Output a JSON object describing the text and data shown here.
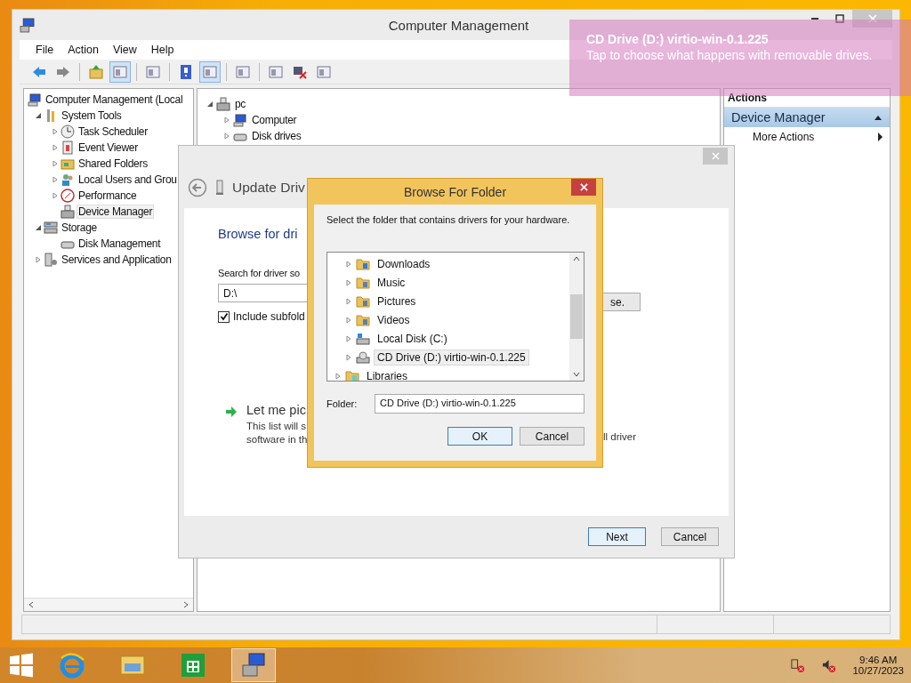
{
  "window": {
    "title": "Computer Management"
  },
  "menu": [
    "File",
    "Action",
    "View",
    "Help"
  ],
  "toolbar": [
    {
      "on": false
    },
    {
      "on": false
    },
    {
      "on": false
    },
    {
      "on": true
    },
    {
      "on": false
    },
    {
      "on": false
    },
    {
      "on": true
    },
    {
      "on": false
    },
    {
      "on": false
    },
    {
      "on": false
    },
    {
      "on": false
    }
  ],
  "tree": [
    {
      "label": "Computer Management (Local",
      "kind": "computer",
      "expandable": false,
      "selected": false,
      "children": [
        {
          "label": "System Tools",
          "kind": "tools",
          "expandable": true,
          "expanded": true,
          "selected": false,
          "children": [
            {
              "label": "Task Scheduler",
              "kind": "clock",
              "expandable": true,
              "expanded": false,
              "selected": false
            },
            {
              "label": "Event Viewer",
              "kind": "log",
              "expandable": true,
              "expanded": false,
              "selected": false
            },
            {
              "label": "Shared Folders",
              "kind": "share",
              "expandable": true,
              "expanded": false,
              "selected": false
            },
            {
              "label": "Local Users and Grou",
              "kind": "users",
              "expandable": true,
              "expanded": false,
              "selected": false
            },
            {
              "label": "Performance",
              "kind": "gauge",
              "expandable": true,
              "expanded": false,
              "selected": false
            },
            {
              "label": "Device Manager",
              "kind": "device",
              "expandable": false,
              "selected": true
            }
          ]
        },
        {
          "label": "Storage",
          "kind": "storage",
          "expandable": true,
          "expanded": true,
          "selected": false,
          "children": [
            {
              "label": "Disk Management",
              "kind": "disk",
              "expandable": false,
              "selected": false
            }
          ]
        },
        {
          "label": "Services and Application",
          "kind": "services",
          "expandable": true,
          "expanded": false,
          "selected": false
        }
      ]
    }
  ],
  "devices": [
    {
      "label": "pc",
      "kind": "device",
      "expanded": true,
      "children": [
        {
          "label": "Computer",
          "kind": "computer",
          "expanded": false
        },
        {
          "label": "Disk drives",
          "kind": "disk",
          "expanded": false
        }
      ]
    }
  ],
  "actions": {
    "title": "Actions",
    "section": "Device Manager",
    "items": [
      "More Actions"
    ]
  },
  "update_dialog": {
    "title": "Update Driv",
    "heading": "Browse for dri",
    "search_label": "Search for driver so",
    "path": "D:\\",
    "include": {
      "label": "Include subfold",
      "checked": true
    },
    "browse_button": "se.",
    "option_title": "Let me pic",
    "option_lines": [
      "This list will s",
      "software in th"
    ],
    "option_right": "ll driver",
    "buttons": [
      "Next",
      "Cancel"
    ]
  },
  "browse_dialog": {
    "title": "Browse For Folder",
    "prompt": "Select the folder that contains drivers for your hardware.",
    "folders": [
      {
        "children": [
          {
            "label": "Downloads",
            "kind": "downloads",
            "selected": false
          },
          {
            "label": "Music",
            "kind": "music",
            "selected": false
          },
          {
            "label": "Pictures",
            "kind": "pictures",
            "selected": false
          },
          {
            "label": "Videos",
            "kind": "videos",
            "selected": false
          },
          {
            "label": "Local Disk (C:)",
            "kind": "localdisk",
            "selected": false
          },
          {
            "label": "CD Drive (D:) virtio-win-0.1.225",
            "kind": "cddrive",
            "selected": true
          }
        ]
      },
      {
        "label": "Libraries",
        "kind": "libraries",
        "selected": false
      }
    ],
    "folder_label": "Folder:",
    "folder_value": "CD Drive (D:) virtio-win-0.1.225",
    "buttons": [
      "OK",
      "Cancel"
    ]
  },
  "toast": {
    "title": "CD Drive (D:) virtio-win-0.1.225",
    "message": "Tap to choose what happens with removable drives."
  },
  "taskbar": {
    "apps": [
      {
        "kind": "ie",
        "active": false
      },
      {
        "kind": "explorer",
        "active": false
      },
      {
        "kind": "store",
        "active": false
      },
      {
        "kind": "mmc",
        "active": true
      }
    ],
    "time": "9:46 AM",
    "date": "10/27/2023"
  }
}
